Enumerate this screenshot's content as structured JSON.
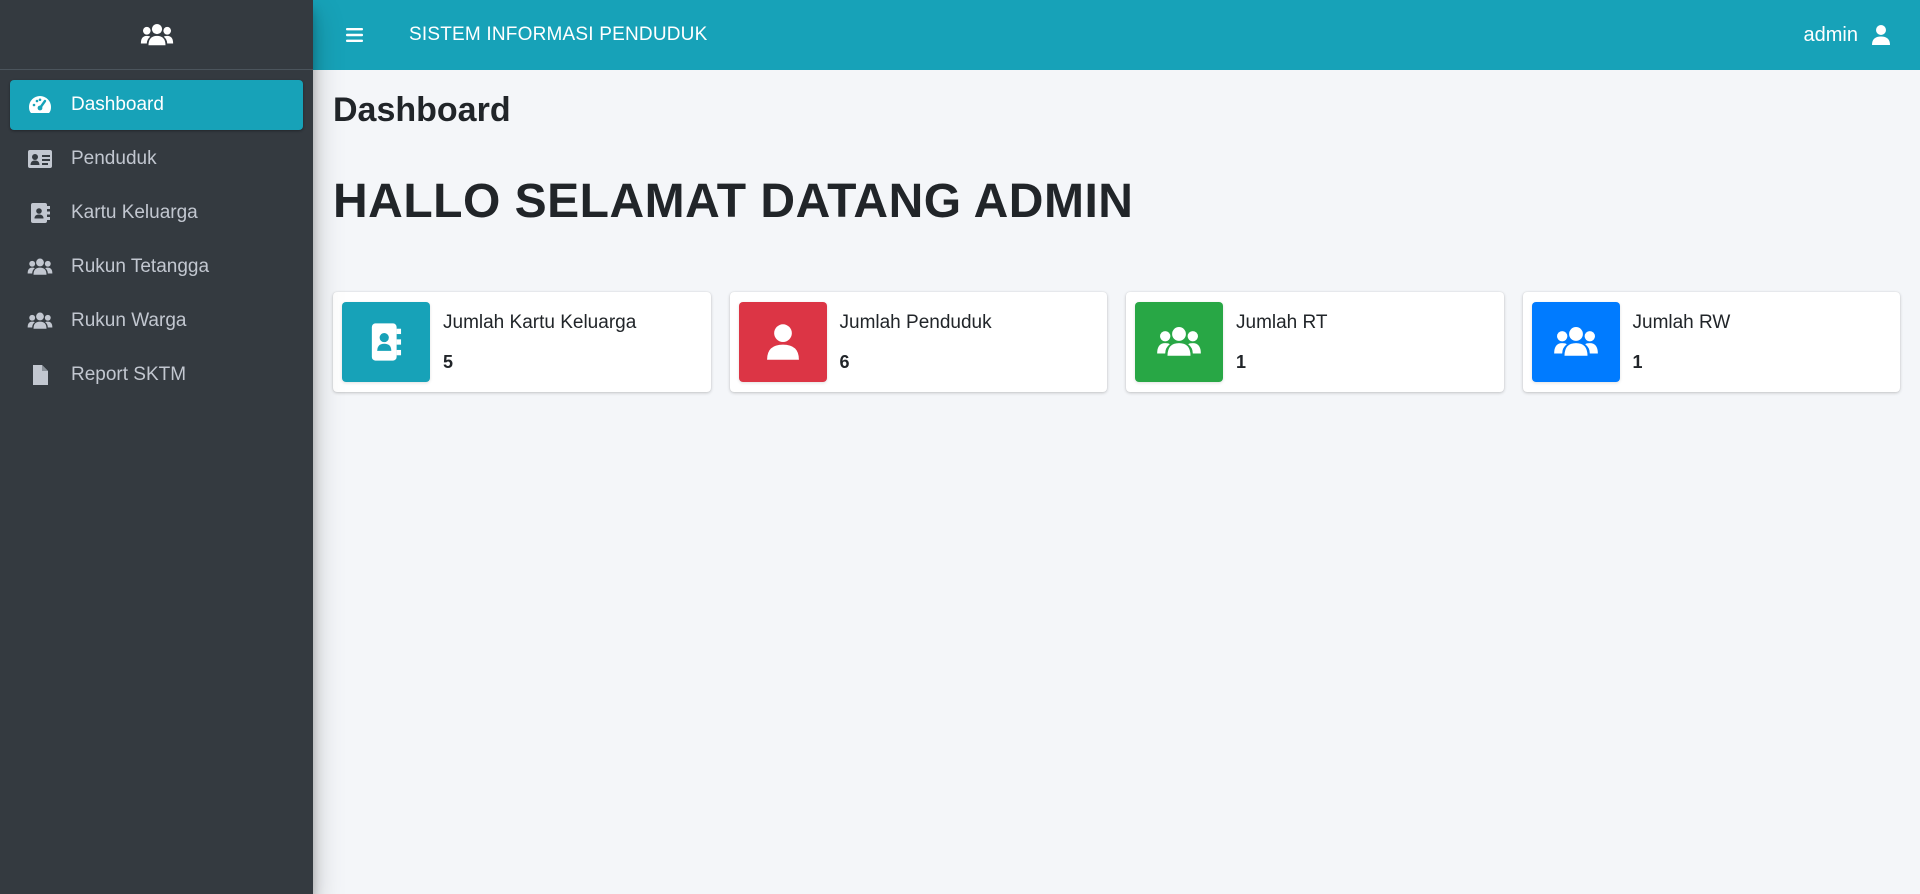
{
  "sidebar": {
    "brand_icon": "users-icon",
    "items": [
      {
        "label": "Dashboard",
        "icon": "tachometer-icon",
        "active": true
      },
      {
        "label": "Penduduk",
        "icon": "id-card-icon",
        "active": false
      },
      {
        "label": "Kartu Keluarga",
        "icon": "address-book-icon",
        "active": false
      },
      {
        "label": "Rukun Tetangga",
        "icon": "users-icon",
        "active": false
      },
      {
        "label": "Rukun Warga",
        "icon": "users-icon",
        "active": false
      },
      {
        "label": "Report SKTM",
        "icon": "file-icon",
        "active": false
      }
    ]
  },
  "topbar": {
    "title": "SISTEM INFORMASI PENDUDUK",
    "user_label": "admin"
  },
  "main": {
    "page_title": "Dashboard",
    "welcome": "HALLO SELAMAT DATANG ADMIN",
    "cards": [
      {
        "label": "Jumlah Kartu Keluarga",
        "value": "5",
        "color": "#17a2b8",
        "icon": "address-book-icon"
      },
      {
        "label": "Jumlah Penduduk",
        "value": "6",
        "color": "#dc3545",
        "icon": "user-icon"
      },
      {
        "label": "Jumlah RT",
        "value": "1",
        "color": "#28a745",
        "icon": "users-icon"
      },
      {
        "label": "Jumlah RW",
        "value": "1",
        "color": "#007bff",
        "icon": "users-icon"
      }
    ]
  },
  "colors": {
    "sidebar_bg": "#343a40",
    "accent": "#17a2b8",
    "page_bg": "#f4f6f9"
  }
}
